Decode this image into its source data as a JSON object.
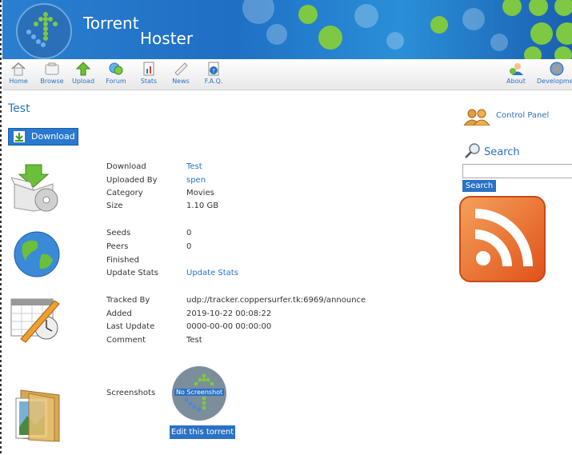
{
  "header": {
    "brand_line1": "Torrent",
    "brand_line2": "Hoster"
  },
  "nav": {
    "items": [
      {
        "label": "Home",
        "icon": "home-icon"
      },
      {
        "label": "Browse",
        "icon": "browse-icon"
      },
      {
        "label": "Upload",
        "icon": "upload-icon"
      },
      {
        "label": "Forum",
        "icon": "forum-icon"
      },
      {
        "label": "Stats",
        "icon": "stats-icon"
      },
      {
        "label": "News",
        "icon": "news-icon"
      },
      {
        "label": "F.A.Q.",
        "icon": "faq-icon"
      },
      {
        "label": "About",
        "icon": "about-icon"
      },
      {
        "label": "Development",
        "icon": "development-icon"
      }
    ]
  },
  "torrent": {
    "title": "Test",
    "download_button": "Download",
    "details": [
      {
        "label": "Download",
        "value": "Test",
        "link": true
      },
      {
        "label": "Uploaded By",
        "value": "spen",
        "link": true
      },
      {
        "label": "Category",
        "value": "Movies",
        "link": false
      },
      {
        "label": "Size",
        "value": "1.10 GB",
        "link": false
      }
    ],
    "peers": [
      {
        "label": "Seeds",
        "value": "0",
        "link": false
      },
      {
        "label": "Peers",
        "value": "0",
        "link": false
      },
      {
        "label": "Finished",
        "value": "",
        "link": false
      },
      {
        "label": "Update Stats",
        "value": "Update Stats",
        "link": true
      }
    ],
    "meta": [
      {
        "label": "Tracked By",
        "value": "udp://tracker.coppersurfer.tk:6969/announce",
        "link": false
      },
      {
        "label": "Added",
        "value": "2019-10-22 00:08:22",
        "link": false
      },
      {
        "label": "Last Update",
        "value": "0000-00-00 00:00:00",
        "link": false
      },
      {
        "label": "Comment",
        "value": "Test",
        "link": false
      }
    ],
    "screenshots_label": "Screenshots",
    "no_screenshot": "No Screenshot",
    "edit_button": "Edit this torrent"
  },
  "sidebar": {
    "control_panel": "Control Panel",
    "search_title": "Search",
    "search_value": "",
    "search_button": "Search"
  },
  "colors": {
    "accent": "#2a72c5",
    "header": "#1f6fc4",
    "rss": "#e8641f"
  }
}
